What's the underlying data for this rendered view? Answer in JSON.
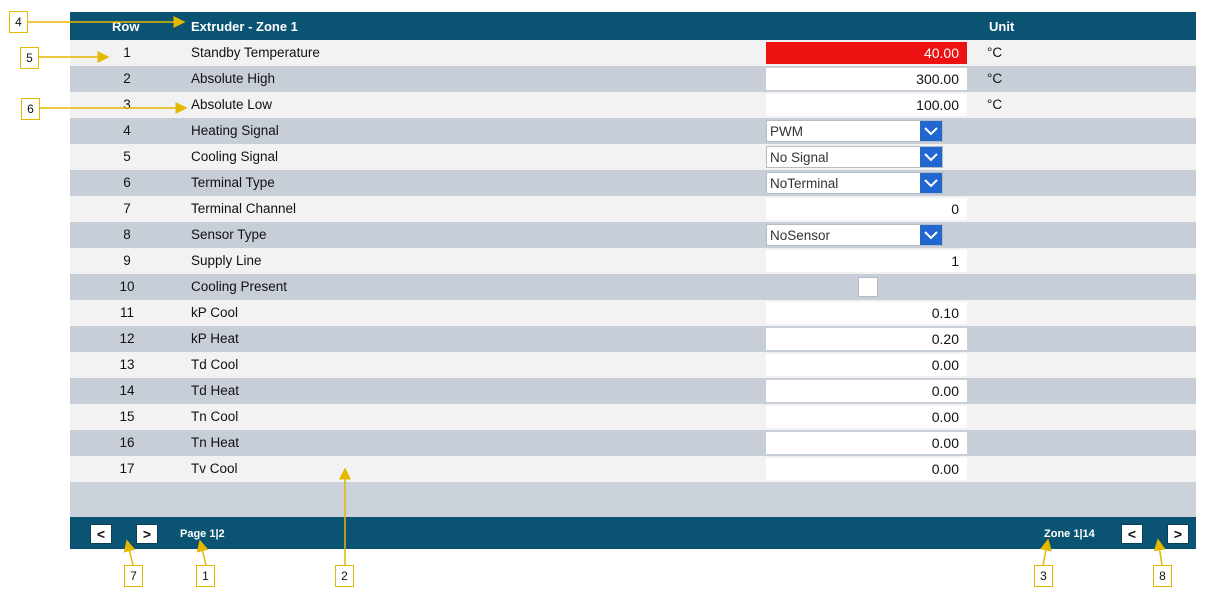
{
  "header": {
    "row_label": "Row",
    "title": "Extruder - Zone 1",
    "unit_label": "Unit"
  },
  "rows": [
    {
      "num": "1",
      "label": "Standby Temperature",
      "value": "40.00",
      "unit": "°C"
    },
    {
      "num": "2",
      "label": "Absolute High",
      "value": "300.00",
      "unit": "°C"
    },
    {
      "num": "3",
      "label": "Absolute Low",
      "value": "100.00",
      "unit": "°C"
    },
    {
      "num": "4",
      "label": "Heating Signal",
      "value": "PWM"
    },
    {
      "num": "5",
      "label": "Cooling Signal",
      "value": "No Signal"
    },
    {
      "num": "6",
      "label": "Terminal Type",
      "value": "NoTerminal"
    },
    {
      "num": "7",
      "label": "Terminal Channel",
      "value": "0"
    },
    {
      "num": "8",
      "label": "Sensor Type",
      "value": "NoSensor"
    },
    {
      "num": "9",
      "label": "Supply Line",
      "value": "1"
    },
    {
      "num": "10",
      "label": "Cooling Present",
      "checked": false
    },
    {
      "num": "11",
      "label": "kP Cool",
      "value": "0.10"
    },
    {
      "num": "12",
      "label": "kP Heat",
      "value": "0.20"
    },
    {
      "num": "13",
      "label": "Td Cool",
      "value": "0.00"
    },
    {
      "num": "14",
      "label": "Td Heat",
      "value": "0.00"
    },
    {
      "num": "15",
      "label": "Tn Cool",
      "value": "0.00"
    },
    {
      "num": "16",
      "label": "Tn Heat",
      "value": "0.00"
    },
    {
      "num": "17",
      "label": "Tv Cool",
      "value": "0.00"
    }
  ],
  "footer": {
    "prev_label": "<",
    "next_label": ">",
    "page_text": "Page 1|2",
    "zone_text": "Zone 1|14"
  },
  "callouts": [
    "1",
    "2",
    "3",
    "4",
    "5",
    "6",
    "7",
    "8"
  ],
  "colors": {
    "header_bg": "#0a5373",
    "alarm": "#ee1111",
    "dropdown": "#2266d0",
    "callout_border": "#e5b800"
  }
}
